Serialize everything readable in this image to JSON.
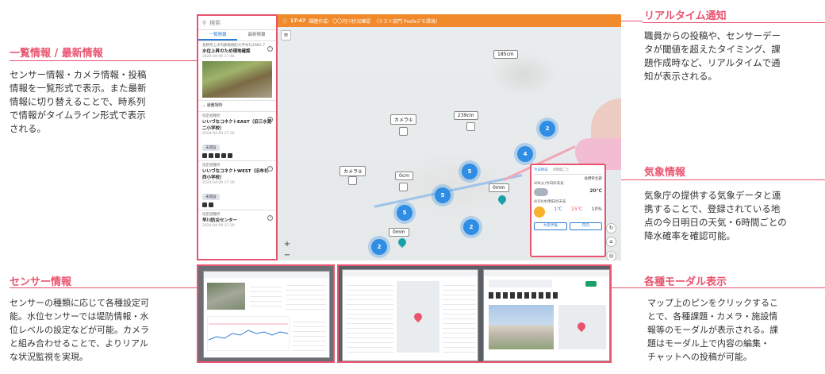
{
  "annotations": {
    "list": {
      "title": "一覧情報 / 最新情報",
      "lines": [
        "センサー情報・カメラ情報・投稿",
        "情報を一覧形式で表示。また最新",
        "情報に切り替えることで、時系列",
        "で情報がタイムライン形式で表示",
        "される。"
      ]
    },
    "realtime": {
      "title": "リアルタイム通知",
      "lines": [
        "職員からの投稿や、センサーデー",
        "タが閾値を超えたタイミング、課",
        "題作成時など、リアルタイムで通",
        "知が表示される。"
      ]
    },
    "weather": {
      "title": "気象情報",
      "lines": [
        "気象庁の提供する気象データと連",
        "携することで、登録されている地",
        "点の今日明日の天気・6時間ごとの",
        "降水確率を確認可能。"
      ]
    },
    "sensor": {
      "title": "センサー情報",
      "lines": [
        "センサーの種類に応じて各種設定可",
        "能。水位センサーでは堤防情報・水",
        "位レベルの設定などが可能。カメラ",
        "と組み合わせることで、よりリアル",
        "な状況監視を実現。"
      ]
    },
    "modal": {
      "title": "各種モーダル表示",
      "lines": [
        "マップ上のピンをクリックするこ",
        "とで、各種課題・カメラ・施設情",
        "報等のモーダルが表示される。課",
        "題はモーダル上で内容の編集・",
        "チャットへの投稿が可能。"
      ]
    }
  },
  "app": {
    "search_placeholder": "検索",
    "tabs": [
      "一覧情報",
      "最新情報"
    ],
    "items": [
      {
        "category": "長野県上水内郡飯綱町大字牟礼2981-7",
        "name": "水位上昇のため現地確認",
        "date": "2024-04-09 17:48"
      },
      {
        "category": "指定避難所",
        "name": "いいづなコネクトEAST（旧三水第二小学校）",
        "date": "2024-04-09 17:30",
        "badge": "未開設"
      },
      {
        "category": "指定避難所",
        "name": "いいづなコネクトWEST（旧牟礼西小学校）",
        "date": "2024-04-09 17:30",
        "badge": "未開設"
      },
      {
        "category": "指定避難所",
        "name": "早川防災センター",
        "date": "2024-04-09 17:30"
      }
    ],
    "section_label": "避難場所",
    "notification": {
      "time": "17:47",
      "text": "課題作成：〇〇河川状況確認",
      "tag": "（テスト部門 Posfeデモ環境）"
    },
    "map_labels": {
      "camera1": "カメラ①",
      "camera2": "カメラ②",
      "s185": "185cm",
      "s239": "239cm",
      "s0a": "0cm",
      "s0b": "0mm",
      "s0c": "0mm"
    },
    "clusters": [
      "2",
      "4",
      "5",
      "5",
      "5",
      "2",
      "2"
    ],
    "weather": {
      "tabs": [
        "今日明日",
        "6時間ごと"
      ],
      "location": "長野県北部",
      "today": "4/9(火)今日の天気",
      "today_temp": "20℃",
      "tomorrow": "4/10(水)明日の天気",
      "t1": "1℃",
      "t2": "15℃",
      "t3": "10%",
      "buttons": [
        "大雨予報",
        "円内"
      ]
    }
  }
}
